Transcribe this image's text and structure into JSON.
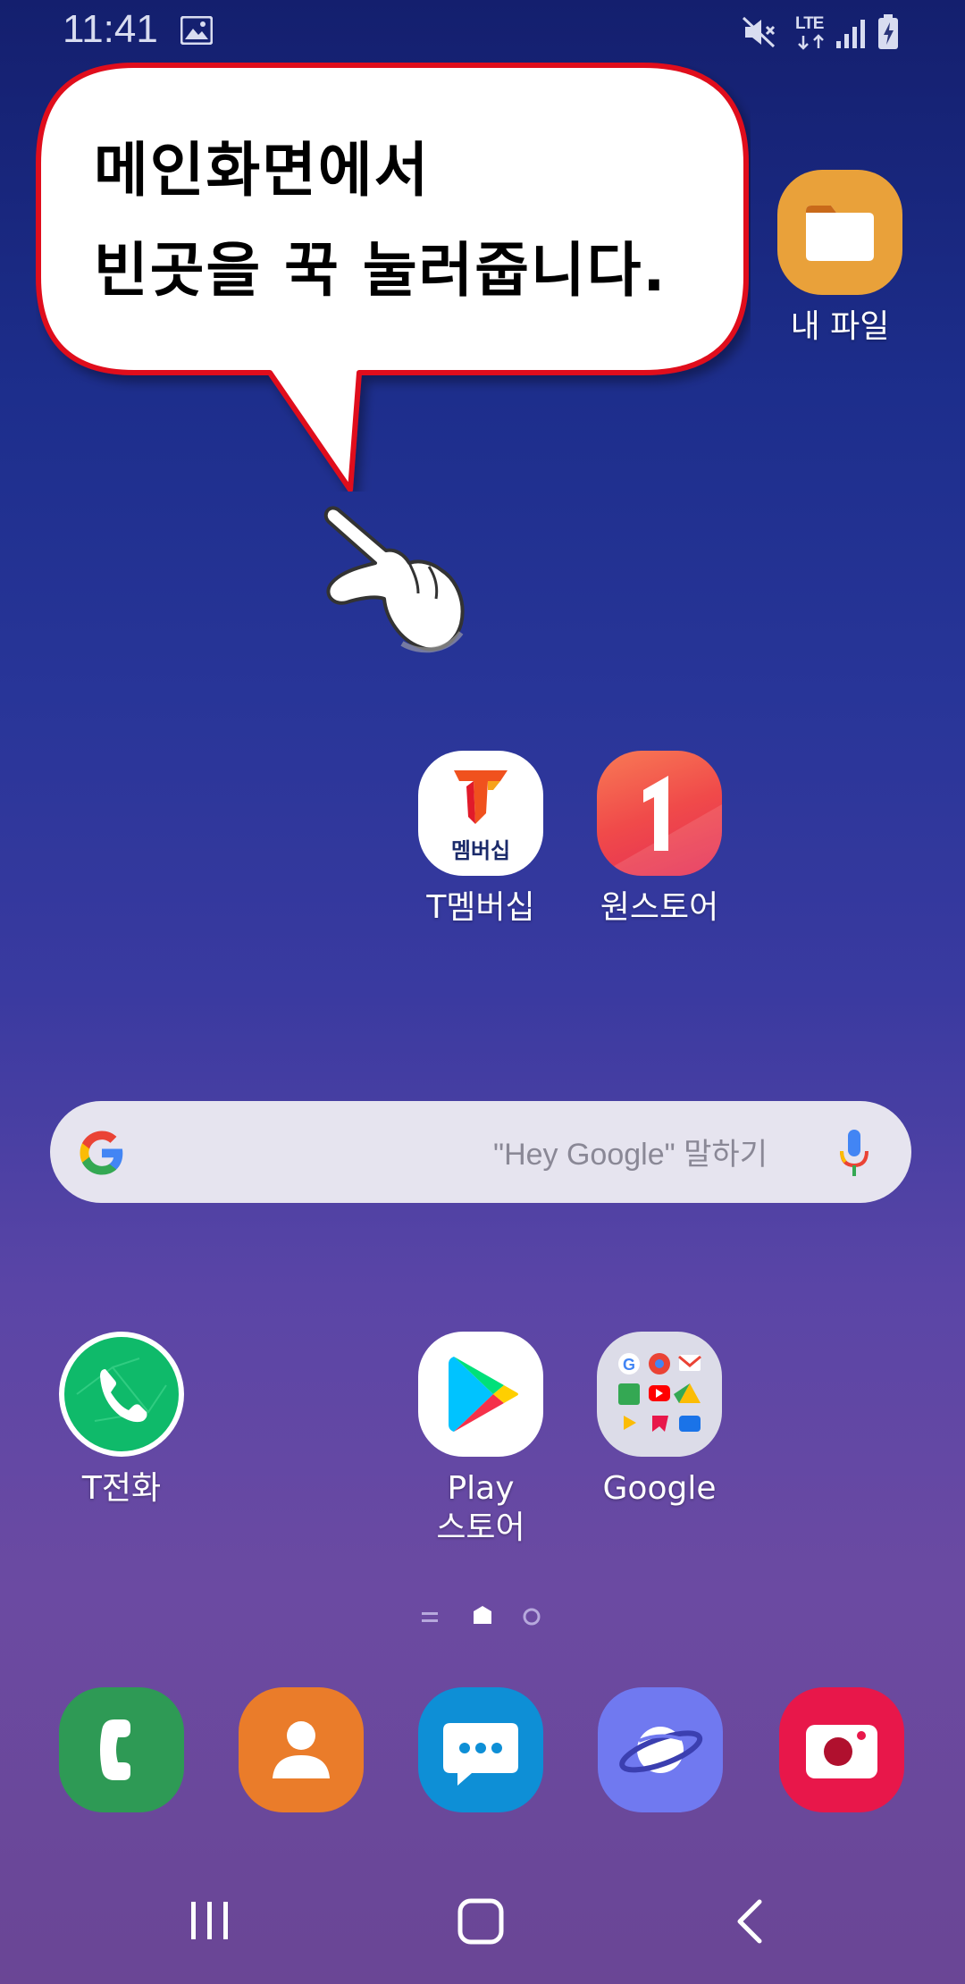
{
  "status_bar": {
    "time": "11:41",
    "network": "LTE"
  },
  "tutorial_bubble": {
    "line1": "메인화면에서",
    "line2": "빈곳을 꾹 눌러줍니다."
  },
  "apps": {
    "my_files": {
      "label": "내 파일",
      "icon": "folder-icon"
    },
    "t_membership": {
      "label": "T멤버십",
      "icon_text": "멤버십"
    },
    "one_store": {
      "label": "원스토어"
    },
    "t_phone": {
      "label": "T전화"
    },
    "play_store": {
      "label_line1": "Play",
      "label_line2": "스토어"
    },
    "google_folder": {
      "label": "Google"
    }
  },
  "search_bar": {
    "placeholder": "\"Hey Google\" 말하기"
  },
  "dock": [
    "phone-icon",
    "contacts-icon",
    "messages-icon",
    "internet-icon",
    "camera-icon"
  ],
  "nav_bar": [
    "recents-button",
    "home-button",
    "back-button"
  ],
  "colors": {
    "bubble_border": "#e0101a",
    "my_files": "#e9a13a",
    "t_phone": "#0fba6a",
    "one_store": "#f04a4a",
    "dock_phone": "#2e9a55",
    "dock_contacts": "#ea7c2a",
    "dock_messages": "#0e8fd6",
    "dock_internet": "#7079f0",
    "dock_camera": "#e8174a"
  }
}
